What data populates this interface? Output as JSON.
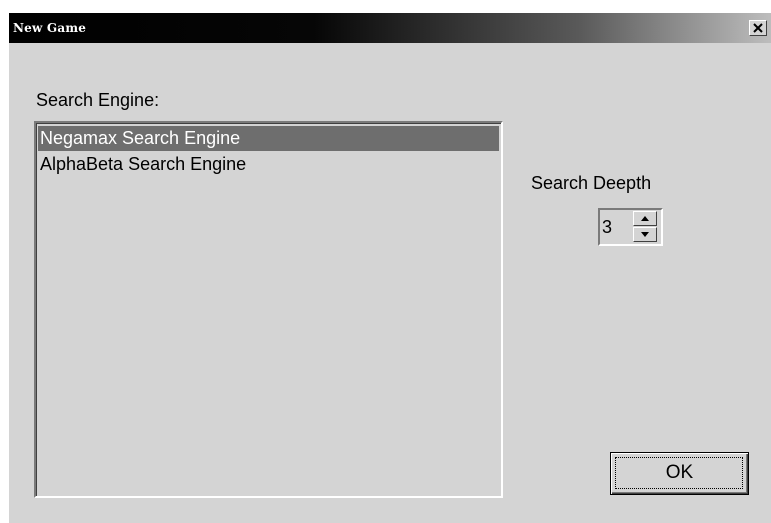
{
  "window": {
    "title": "New Game"
  },
  "engine": {
    "label": "Search Engine:",
    "items": [
      {
        "label": "Negamax Search Engine",
        "selected": true
      },
      {
        "label": "AlphaBeta Search Engine",
        "selected": false
      }
    ]
  },
  "depth": {
    "label": "Search Deepth",
    "value": "3"
  },
  "buttons": {
    "ok_label": "OK"
  },
  "icons": {
    "close": "close-icon",
    "spin_up": "arrow-up-icon",
    "spin_down": "arrow-down-icon"
  },
  "colors": {
    "dialog_bg": "#d4d4d4",
    "selection_bg": "#6e6e6e",
    "title_fg": "#ffffff"
  }
}
